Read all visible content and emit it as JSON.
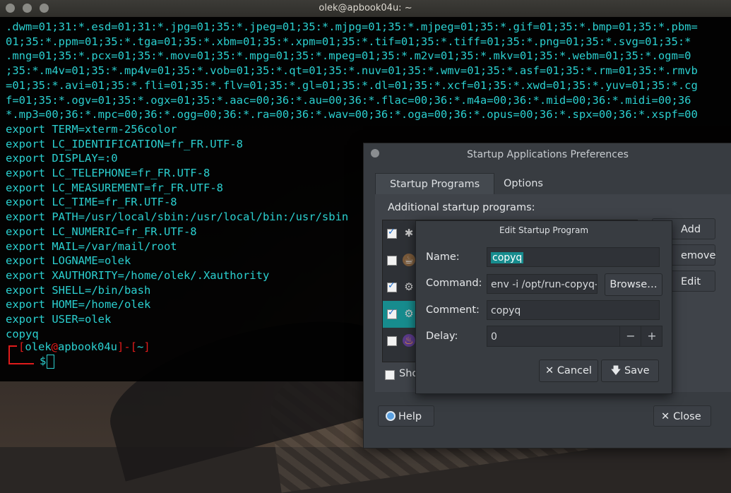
{
  "terminal": {
    "title": "olek@apbook04u: ~",
    "lines": [
      ".dwm=01;31:*.esd=01;31:*.jpg=01;35:*.jpeg=01;35:*.mjpg=01;35:*.mjpeg=01;35:*.gif=01;35:*.bmp=01;35:*.pbm=",
      "01;35:*.ppm=01;35:*.tga=01;35:*.xbm=01;35:*.xpm=01;35:*.tif=01;35:*.tiff=01;35:*.png=01;35:*.svg=01;35:*",
      ".mng=01;35:*.pcx=01;35:*.mov=01;35:*.mpg=01;35:*.mpeg=01;35:*.m2v=01;35:*.mkv=01;35:*.webm=01;35:*.ogm=0",
      ";35:*.m4v=01;35:*.mp4v=01;35:*.vob=01;35:*.qt=01;35:*.nuv=01;35:*.wmv=01;35:*.asf=01;35:*.rm=01;35:*.rmvb",
      "=01;35:*.avi=01;35:*.fli=01;35:*.flv=01;35:*.gl=01;35:*.dl=01;35:*.xcf=01;35:*.xwd=01;35:*.yuv=01;35:*.cg",
      "f=01;35:*.ogv=01;35:*.ogx=01;35:*.aac=00;36:*.au=00;36:*.flac=00;36:*.m4a=00;36:*.mid=00;36:*.midi=00;36",
      "*.mp3=00;36:*.mpc=00;36:*.ogg=00;36:*.ra=00;36:*.wav=00;36:*.oga=00;36:*.opus=00;36:*.spx=00;36:*.xspf=00",
      "export TERM=xterm-256color",
      "export LC_IDENTIFICATION=fr_FR.UTF-8",
      "export DISPLAY=:0",
      "export LC_TELEPHONE=fr_FR.UTF-8",
      "export LC_MEASUREMENT=fr_FR.UTF-8",
      "export LC_TIME=fr_FR.UTF-8",
      "export PATH=/usr/local/sbin:/usr/local/bin:/usr/sbin",
      "export LC_NUMERIC=fr_FR.UTF-8",
      "export MAIL=/var/mail/root",
      "export LOGNAME=olek",
      "export XAUTHORITY=/home/olek/.Xauthority",
      "export SHELL=/bin/bash",
      "export HOME=/home/olek",
      "export USER=olek",
      "copyq"
    ],
    "prompt": {
      "open": "[",
      "user": "olek",
      "at": "@",
      "host": "apbook04u",
      "sep": "]-[",
      "dir": "~",
      "close": "]",
      "symbol": "$"
    }
  },
  "startup_dialog": {
    "title": "Startup Applications Preferences",
    "tabs": [
      {
        "label": "Startup Programs"
      },
      {
        "label": "Options"
      }
    ],
    "section_label": "Additional startup programs:",
    "rows": [
      {
        "checked": true,
        "icon": "bluetooth-icon",
        "glyph": "✱"
      },
      {
        "checked": false,
        "icon": "coffee-icon",
        "glyph": "☕"
      },
      {
        "checked": true,
        "icon": "gears-icon",
        "glyph": "⚙"
      },
      {
        "checked": true,
        "icon": "gears-icon",
        "glyph": "⚙",
        "selected": true
      },
      {
        "checked": false,
        "icon": "flame-icon",
        "glyph": "♨"
      }
    ],
    "buttons": {
      "add": "Add",
      "remove": "emove",
      "edit": "Edit"
    },
    "show_label": "Sho",
    "help": "Help",
    "close": "Close"
  },
  "edit_dialog": {
    "title": "Edit Startup Program",
    "name_label": "Name:",
    "name_value": "copyq",
    "command_label": "Command:",
    "command_value": "env -i /opt/run-copyq-e",
    "browse": "Browse…",
    "comment_label": "Comment:",
    "comment_value": "copyq",
    "delay_label": "Delay:",
    "delay_value": "0",
    "minus": "−",
    "plus": "+",
    "cancel": "Cancel",
    "save": "Save"
  },
  "colors": {
    "terminal_text": "#2bd0d0",
    "prompt_red": "#e01b1b",
    "selection": "#178c8e",
    "dialog_bg": "#383c41"
  }
}
